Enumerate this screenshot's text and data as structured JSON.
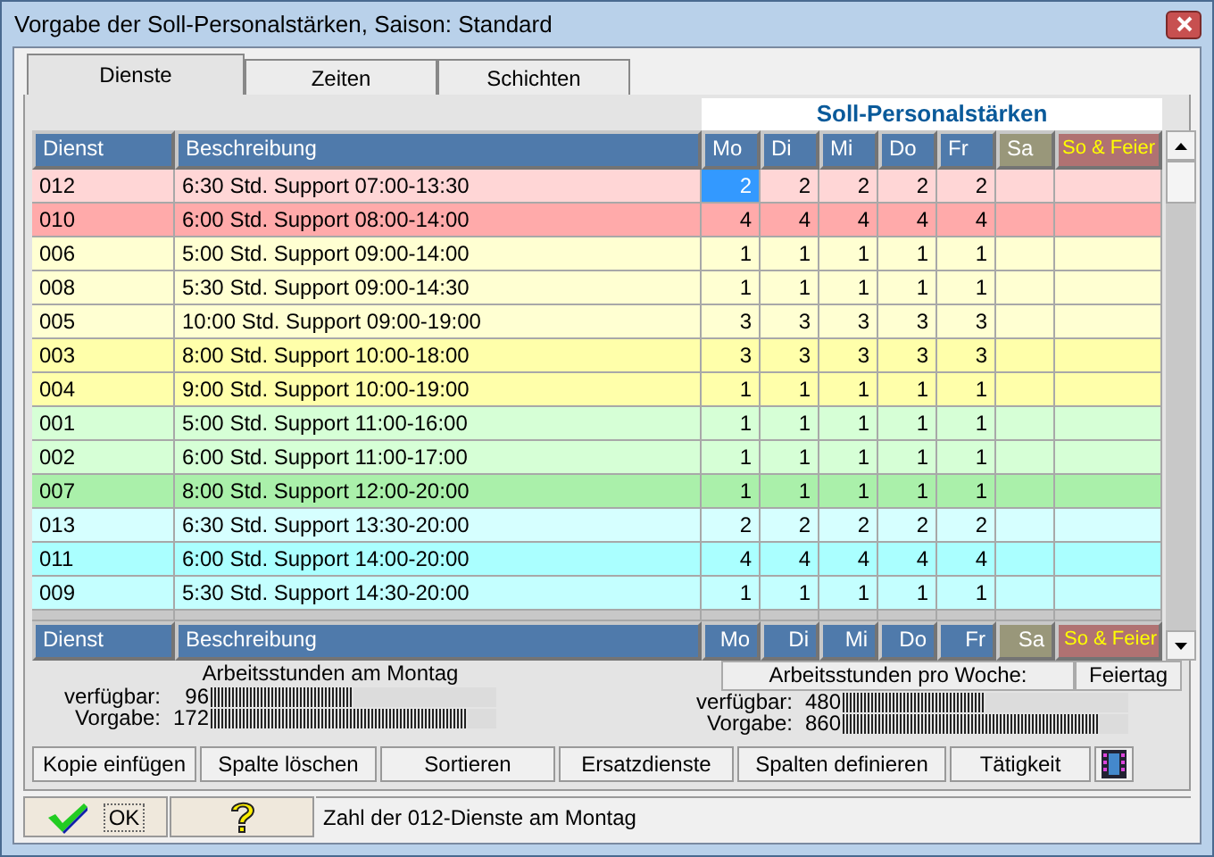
{
  "window": {
    "title": "Vorgabe der Soll-Personalstärken, Saison: Standard"
  },
  "tabs": [
    {
      "label": "Dienste",
      "selected": true
    },
    {
      "label": "Zeiten",
      "selected": false
    },
    {
      "label": "Schichten",
      "selected": false
    }
  ],
  "table": {
    "group_title": "Soll-Personalstärken",
    "columns": [
      {
        "label": "Dienst",
        "kind": "text"
      },
      {
        "label": "Beschreibung",
        "kind": "text"
      },
      {
        "label": "Mo",
        "kind": "weekday"
      },
      {
        "label": "Di",
        "kind": "weekday"
      },
      {
        "label": "Mi",
        "kind": "weekday"
      },
      {
        "label": "Do",
        "kind": "weekday"
      },
      {
        "label": "Fr",
        "kind": "weekday"
      },
      {
        "label": "Sa",
        "kind": "saturday"
      },
      {
        "label": "So & Feier",
        "kind": "holiday"
      }
    ],
    "rows": [
      {
        "dienst": "012",
        "beschreibung": "6:30 Std.  Support 07:00-13:30",
        "color": "#ffd6d6",
        "cells": [
          {
            "value": "2",
            "selected": true
          },
          {
            "value": "2",
            "selected": false
          },
          {
            "value": "2",
            "selected": false
          },
          {
            "value": "2",
            "selected": false
          },
          {
            "value": "2",
            "selected": false
          }
        ]
      },
      {
        "dienst": "010",
        "beschreibung": "6:00 Std.  Support 08:00-14:00",
        "color": "#ffaaaa",
        "cells": [
          {
            "value": "4",
            "selected": false
          },
          {
            "value": "4",
            "selected": false
          },
          {
            "value": "4",
            "selected": false
          },
          {
            "value": "4",
            "selected": false
          },
          {
            "value": "4",
            "selected": false
          }
        ]
      },
      {
        "dienst": "006",
        "beschreibung": "5:00 Std.  Support 09:00-14:00",
        "color": "#ffffd2",
        "cells": [
          {
            "value": "1",
            "selected": false
          },
          {
            "value": "1",
            "selected": false
          },
          {
            "value": "1",
            "selected": false
          },
          {
            "value": "1",
            "selected": false
          },
          {
            "value": "1",
            "selected": false
          }
        ]
      },
      {
        "dienst": "008",
        "beschreibung": "5:30 Std.  Support 09:00-14:30",
        "color": "#ffffd2",
        "cells": [
          {
            "value": "1",
            "selected": false
          },
          {
            "value": "1",
            "selected": false
          },
          {
            "value": "1",
            "selected": false
          },
          {
            "value": "1",
            "selected": false
          },
          {
            "value": "1",
            "selected": false
          }
        ]
      },
      {
        "dienst": "005",
        "beschreibung": "10:00 Std.  Support 09:00-19:00",
        "color": "#ffffd2",
        "cells": [
          {
            "value": "3",
            "selected": false
          },
          {
            "value": "3",
            "selected": false
          },
          {
            "value": "3",
            "selected": false
          },
          {
            "value": "3",
            "selected": false
          },
          {
            "value": "3",
            "selected": false
          }
        ]
      },
      {
        "dienst": "003",
        "beschreibung": "8:00 Std.  Support 10:00-18:00",
        "color": "#ffffaa",
        "cells": [
          {
            "value": "3",
            "selected": false
          },
          {
            "value": "3",
            "selected": false
          },
          {
            "value": "3",
            "selected": false
          },
          {
            "value": "3",
            "selected": false
          },
          {
            "value": "3",
            "selected": false
          }
        ]
      },
      {
        "dienst": "004",
        "beschreibung": "9:00 Std.  Support 10:00-19:00",
        "color": "#ffffaa",
        "cells": [
          {
            "value": "1",
            "selected": false
          },
          {
            "value": "1",
            "selected": false
          },
          {
            "value": "1",
            "selected": false
          },
          {
            "value": "1",
            "selected": false
          },
          {
            "value": "1",
            "selected": false
          }
        ]
      },
      {
        "dienst": "001",
        "beschreibung": "5:00 Std.  Support 11:00-16:00",
        "color": "#d6ffd6",
        "cells": [
          {
            "value": "1",
            "selected": false
          },
          {
            "value": "1",
            "selected": false
          },
          {
            "value": "1",
            "selected": false
          },
          {
            "value": "1",
            "selected": false
          },
          {
            "value": "1",
            "selected": false
          }
        ]
      },
      {
        "dienst": "002",
        "beschreibung": "6:00 Std.  Support 11:00-17:00",
        "color": "#d6ffd6",
        "cells": [
          {
            "value": "1",
            "selected": false
          },
          {
            "value": "1",
            "selected": false
          },
          {
            "value": "1",
            "selected": false
          },
          {
            "value": "1",
            "selected": false
          },
          {
            "value": "1",
            "selected": false
          }
        ]
      },
      {
        "dienst": "007",
        "beschreibung": "8:00 Std.  Support 12:00-20:00",
        "color": "#aaf0aa",
        "cells": [
          {
            "value": "1",
            "selected": false
          },
          {
            "value": "1",
            "selected": false
          },
          {
            "value": "1",
            "selected": false
          },
          {
            "value": "1",
            "selected": false
          },
          {
            "value": "1",
            "selected": false
          }
        ]
      },
      {
        "dienst": "013",
        "beschreibung": "6:30 Std.  Support 13:30-20:00",
        "color": "#d6ffff",
        "cells": [
          {
            "value": "2",
            "selected": false
          },
          {
            "value": "2",
            "selected": false
          },
          {
            "value": "2",
            "selected": false
          },
          {
            "value": "2",
            "selected": false
          },
          {
            "value": "2",
            "selected": false
          }
        ]
      },
      {
        "dienst": "011",
        "beschreibung": "6:00 Std.  Support 14:00-20:00",
        "color": "#aaffff",
        "cells": [
          {
            "value": "4",
            "selected": false
          },
          {
            "value": "4",
            "selected": false
          },
          {
            "value": "4",
            "selected": false
          },
          {
            "value": "4",
            "selected": false
          },
          {
            "value": "4",
            "selected": false
          }
        ]
      },
      {
        "dienst": "009",
        "beschreibung": "5:30 Std.  Support 14:30-20:00",
        "color": "#c4ffff",
        "cells": [
          {
            "value": "1",
            "selected": false
          },
          {
            "value": "1",
            "selected": false
          },
          {
            "value": "1",
            "selected": false
          },
          {
            "value": "1",
            "selected": false
          },
          {
            "value": "1",
            "selected": false
          }
        ]
      }
    ],
    "footer": [
      {
        "label": "Dienst",
        "kind": "text"
      },
      {
        "label": "Beschreibung",
        "kind": "text"
      },
      {
        "label": "Mo",
        "kind": "weekday"
      },
      {
        "label": "Di",
        "kind": "weekday"
      },
      {
        "label": "Mi",
        "kind": "weekday"
      },
      {
        "label": "Do",
        "kind": "weekday"
      },
      {
        "label": "Fr",
        "kind": "weekday"
      },
      {
        "label": "Sa",
        "kind": "saturday"
      },
      {
        "label": "So & Feier",
        "kind": "holiday"
      }
    ]
  },
  "summary": {
    "day_title": "Arbeitsstunden am Montag",
    "week_title": "Arbeitsstunden pro Woche:",
    "holiday_title": "Feiertag",
    "day": [
      {
        "label": "verfügbar:",
        "value": "96",
        "level": 0.5
      },
      {
        "label": "Vorgabe:",
        "value": "172",
        "level": 0.9
      }
    ],
    "week": [
      {
        "label": "verfügbar:",
        "value": "480",
        "level": 0.5
      },
      {
        "label": "Vorgabe:",
        "value": "860",
        "level": 0.9
      }
    ]
  },
  "actions": [
    "Kopie einfügen",
    "Spalte löschen",
    "Sortieren",
    "Ersatzdienste",
    "Spalten definieren",
    "Tätigkeit"
  ],
  "ok_button": "OK",
  "status": "Zahl der 012-Dienste am Montag"
}
